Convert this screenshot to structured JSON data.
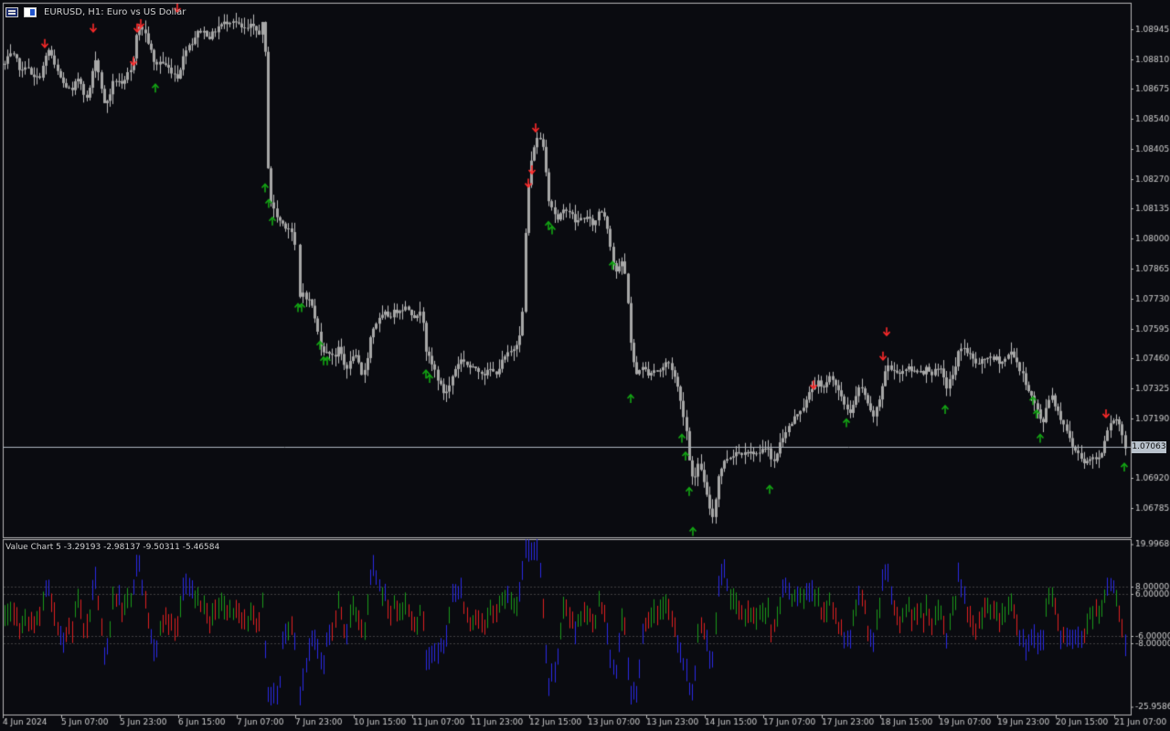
{
  "window": {
    "symbol_title": "EURUSD, H1:  Euro vs US Dollar",
    "icons": [
      "chart-grid-icon",
      "one-click-trading-icon"
    ]
  },
  "main_chart": {
    "price_axis_labels": [
      "1.08945",
      "1.08810",
      "1.08675",
      "1.08540",
      "1.08405",
      "1.08270",
      "1.08135",
      "1.08000",
      "1.07865",
      "1.07730",
      "1.07595",
      "1.07460",
      "1.07325",
      "1.07190",
      "1.06920",
      "1.06785"
    ],
    "current_price": "1.07063",
    "colors": {
      "background": "#0a0b10",
      "candle": "#a7a7a7",
      "candle_wick": "#bdbdbd",
      "up_arrow": "#14a814",
      "down_arrow": "#ff2a2a",
      "price_line": "#b0b8c0",
      "grid_border": "#b8b8b8"
    }
  },
  "indicator": {
    "label": "Value Chart 5 -3.29193 -2.98137 -9.50311 -5.46584",
    "axis_labels": [
      "19.99680",
      "8.00000",
      "6.00000",
      "-6.00000",
      "-8.00000",
      "-25.95862"
    ],
    "colors": {
      "green": "#1a9a1a",
      "red": "#e02020",
      "blue": "#2a2ae6",
      "level_line": "#404040"
    }
  },
  "time_axis_labels": [
    "4 Jun 2024",
    "5 Jun 07:00",
    "5 Jun 23:00",
    "6 Jun 15:00",
    "7 Jun 07:00",
    "7 Jun 23:00",
    "10 Jun 15:00",
    "11 Jun 07:00",
    "11 Jun 23:00",
    "12 Jun 15:00",
    "13 Jun 07:00",
    "13 Jun 23:00",
    "14 Jun 15:00",
    "17 Jun 07:00",
    "17 Jun 23:00",
    "18 Jun 15:00",
    "19 Jun 07:00",
    "19 Jun 23:00",
    "20 Jun 15:00",
    "21 Jun 07:00"
  ],
  "chart_data": {
    "type": "candlestick",
    "title": "EURUSD, H1:  Euro vs US Dollar",
    "xlabel": "",
    "ylabel": "",
    "ylim": [
      1.0665,
      1.0907
    ],
    "close_approx": [
      [
        0,
        1.0872
      ],
      [
        6,
        1.088
      ],
      [
        12,
        1.0883
      ],
      [
        17,
        1.0881
      ],
      [
        20,
        1.0878
      ],
      [
        24,
        1.0875
      ],
      [
        29,
        1.088
      ],
      [
        34,
        1.0873
      ],
      [
        39,
        1.0872
      ],
      [
        44,
        1.0874
      ],
      [
        49,
        1.0881
      ],
      [
        54,
        1.0886
      ],
      [
        59,
        1.0878
      ],
      [
        64,
        1.0874
      ],
      [
        69,
        1.087
      ],
      [
        74,
        1.0868
      ],
      [
        79,
        1.0866
      ],
      [
        84,
        1.0873
      ],
      [
        89,
        1.087
      ],
      [
        94,
        1.0862
      ],
      [
        99,
        1.087
      ],
      [
        104,
        1.0882
      ],
      [
        109,
        1.0872
      ],
      [
        114,
        1.086
      ],
      [
        119,
        1.0864
      ],
      [
        124,
        1.0871
      ],
      [
        129,
        1.0872
      ],
      [
        134,
        1.0868
      ],
      [
        139,
        1.0874
      ],
      [
        144,
        1.0876
      ],
      [
        149,
        1.0893
      ],
      [
        154,
        1.0896
      ],
      [
        159,
        1.0892
      ],
      [
        164,
        1.0886
      ],
      [
        169,
        1.0878
      ],
      [
        174,
        1.088
      ],
      [
        179,
        1.0879
      ],
      [
        184,
        1.0877
      ],
      [
        189,
        1.0875
      ],
      [
        194,
        1.0873
      ],
      [
        199,
        1.088
      ],
      [
        204,
        1.0887
      ],
      [
        209,
        1.0888
      ],
      [
        214,
        1.0892
      ],
      [
        219,
        1.0894
      ],
      [
        224,
        1.0893
      ],
      [
        229,
        1.0891
      ],
      [
        234,
        1.0893
      ],
      [
        239,
        1.0896
      ],
      [
        244,
        1.0897
      ],
      [
        249,
        1.0898
      ],
      [
        254,
        1.0899
      ],
      [
        259,
        1.0897
      ],
      [
        264,
        1.0895
      ],
      [
        269,
        1.0894
      ],
      [
        274,
        1.0896
      ],
      [
        279,
        1.0894
      ],
      [
        284,
        1.0893
      ],
      [
        289,
        1.09
      ],
      [
        292,
        1.0838
      ],
      [
        296,
        1.0817
      ],
      [
        301,
        1.0811
      ],
      [
        306,
        1.0808
      ],
      [
        311,
        1.0806
      ],
      [
        316,
        1.0805
      ],
      [
        321,
        1.0801
      ],
      [
        326,
        1.0771
      ],
      [
        331,
        1.0776
      ],
      [
        336,
        1.0773
      ],
      [
        341,
        1.077
      ],
      [
        346,
        1.076
      ],
      [
        351,
        1.0752
      ],
      [
        356,
        1.0748
      ],
      [
        361,
        1.0749
      ],
      [
        366,
        1.0747
      ],
      [
        371,
        1.0751
      ],
      [
        376,
        1.0743
      ],
      [
        381,
        1.0742
      ],
      [
        386,
        1.0748
      ],
      [
        391,
        1.0745
      ],
      [
        396,
        1.0737
      ],
      [
        401,
        1.0745
      ],
      [
        406,
        1.0758
      ],
      [
        411,
        1.0762
      ],
      [
        416,
        1.0764
      ],
      [
        421,
        1.0766
      ],
      [
        426,
        1.0765
      ],
      [
        431,
        1.0767
      ],
      [
        436,
        1.0768
      ],
      [
        441,
        1.0769
      ],
      [
        446,
        1.0769
      ],
      [
        451,
        1.0766
      ],
      [
        456,
        1.0764
      ],
      [
        461,
        1.077
      ],
      [
        466,
        1.0749
      ],
      [
        471,
        1.0744
      ],
      [
        476,
        1.074
      ],
      [
        481,
        1.0734
      ],
      [
        486,
        1.073
      ],
      [
        491,
        1.0733
      ],
      [
        496,
        1.074
      ],
      [
        501,
        1.0744
      ],
      [
        506,
        1.0746
      ],
      [
        511,
        1.0743
      ],
      [
        516,
        1.0741
      ],
      [
        521,
        1.0742
      ],
      [
        526,
        1.074
      ],
      [
        531,
        1.0739
      ],
      [
        536,
        1.0741
      ],
      [
        541,
        1.0739
      ],
      [
        546,
        1.0742
      ],
      [
        551,
        1.0746
      ],
      [
        556,
        1.0748
      ],
      [
        561,
        1.075
      ],
      [
        566,
        1.0754
      ],
      [
        571,
        1.0762
      ],
      [
        576,
        1.0818
      ],
      [
        580,
        1.0832
      ],
      [
        585,
        1.0844
      ],
      [
        590,
        1.0846
      ],
      [
        595,
        1.084
      ],
      [
        600,
        1.0818
      ],
      [
        605,
        1.0813
      ],
      [
        610,
        1.0808
      ],
      [
        615,
        1.0812
      ],
      [
        620,
        1.0814
      ],
      [
        625,
        1.0811
      ],
      [
        630,
        1.0807
      ],
      [
        635,
        1.0809
      ],
      [
        640,
        1.081
      ],
      [
        645,
        1.0808
      ],
      [
        650,
        1.0806
      ],
      [
        655,
        1.0813
      ],
      [
        660,
        1.0812
      ],
      [
        665,
        1.0804
      ],
      [
        670,
        1.079
      ],
      [
        675,
        1.0784
      ],
      [
        680,
        1.079
      ],
      [
        685,
        1.0781
      ],
      [
        690,
        1.0752
      ],
      [
        695,
        1.0738
      ],
      [
        700,
        1.0742
      ],
      [
        705,
        1.0741
      ],
      [
        710,
        1.0739
      ],
      [
        715,
        1.0741
      ],
      [
        720,
        1.074
      ],
      [
        725,
        1.0742
      ],
      [
        730,
        1.0745
      ],
      [
        735,
        1.0741
      ],
      [
        740,
        1.0735
      ],
      [
        745,
        1.0725
      ],
      [
        750,
        1.0716
      ],
      [
        755,
        1.0695
      ],
      [
        760,
        1.0692
      ],
      [
        765,
        1.07
      ],
      [
        770,
        1.0689
      ],
      [
        775,
        1.068
      ],
      [
        780,
        1.0674
      ],
      [
        785,
        1.0692
      ],
      [
        790,
        1.0698
      ],
      [
        795,
        1.0701
      ],
      [
        800,
        1.0702
      ],
      [
        805,
        1.0704
      ],
      [
        810,
        1.0703
      ],
      [
        815,
        1.0705
      ],
      [
        820,
        1.0703
      ],
      [
        825,
        1.0704
      ],
      [
        830,
        1.0702
      ],
      [
        835,
        1.0705
      ],
      [
        840,
        1.0707
      ],
      [
        845,
        1.0697
      ],
      [
        850,
        1.0704
      ],
      [
        855,
        1.071
      ],
      [
        860,
        1.0714
      ],
      [
        865,
        1.0716
      ],
      [
        870,
        1.072
      ],
      [
        875,
        1.0723
      ],
      [
        880,
        1.0725
      ],
      [
        885,
        1.073
      ],
      [
        890,
        1.0734
      ],
      [
        895,
        1.0735
      ],
      [
        900,
        1.0731
      ],
      [
        905,
        1.0737
      ],
      [
        910,
        1.0738
      ],
      [
        915,
        1.0733
      ],
      [
        920,
        1.0728
      ],
      [
        925,
        1.0724
      ],
      [
        930,
        1.0722
      ],
      [
        935,
        1.0727
      ],
      [
        940,
        1.0733
      ],
      [
        945,
        1.0731
      ],
      [
        950,
        1.0723
      ],
      [
        955,
        1.072
      ],
      [
        960,
        1.0724
      ],
      [
        965,
        1.0734
      ],
      [
        970,
        1.0744
      ],
      [
        975,
        1.074
      ],
      [
        980,
        1.0741
      ],
      [
        985,
        1.0739
      ],
      [
        990,
        1.0742
      ],
      [
        995,
        1.0741
      ],
      [
        1000,
        1.074
      ],
      [
        1005,
        1.0741
      ],
      [
        1010,
        1.074
      ],
      [
        1015,
        1.0742
      ],
      [
        1020,
        1.0739
      ],
      [
        1025,
        1.0741
      ],
      [
        1030,
        1.074
      ],
      [
        1035,
        1.0733
      ],
      [
        1040,
        1.0737
      ],
      [
        1045,
        1.0742
      ],
      [
        1050,
        1.0752
      ],
      [
        1055,
        1.075
      ],
      [
        1060,
        1.0748
      ],
      [
        1065,
        1.0745
      ],
      [
        1070,
        1.0743
      ],
      [
        1075,
        1.0745
      ],
      [
        1080,
        1.0747
      ],
      [
        1085,
        1.0745
      ],
      [
        1090,
        1.0746
      ],
      [
        1095,
        1.0744
      ],
      [
        1100,
        1.0746
      ],
      [
        1105,
        1.0749
      ],
      [
        1110,
        1.0747
      ],
      [
        1115,
        1.0741
      ],
      [
        1120,
        1.0737
      ],
      [
        1125,
        1.0732
      ],
      [
        1130,
        1.0727
      ],
      [
        1135,
        1.0722
      ],
      [
        1140,
        1.0715
      ],
      [
        1145,
        1.0726
      ],
      [
        1150,
        1.073
      ],
      [
        1155,
        1.0724
      ],
      [
        1160,
        1.0719
      ],
      [
        1165,
        1.0716
      ],
      [
        1170,
        1.0709
      ],
      [
        1175,
        1.0705
      ],
      [
        1180,
        1.0703
      ],
      [
        1185,
        1.07
      ],
      [
        1190,
        1.0699
      ],
      [
        1195,
        1.0702
      ],
      [
        1200,
        1.07
      ],
      [
        1205,
        1.0704
      ],
      [
        1210,
        1.0713
      ],
      [
        1215,
        1.0718
      ],
      [
        1220,
        1.0719
      ],
      [
        1225,
        1.0716
      ],
      [
        1230,
        1.0706
      ]
    ],
    "up_arrows": [
      [
        170,
        1.0868
      ],
      [
        290,
        1.0823
      ],
      [
        294,
        1.0816
      ],
      [
        298,
        1.0808
      ],
      [
        326,
        1.0769
      ],
      [
        330,
        1.0769
      ],
      [
        350,
        1.0752
      ],
      [
        354,
        1.0745
      ],
      [
        358,
        1.0745
      ],
      [
        466,
        1.0739
      ],
      [
        470,
        1.0737
      ],
      [
        600,
        1.0806
      ],
      [
        604,
        1.0804
      ],
      [
        670,
        1.0788
      ],
      [
        690,
        1.0728
      ],
      [
        746,
        1.071
      ],
      [
        750,
        1.0702
      ],
      [
        754,
        1.0686
      ],
      [
        758,
        1.0668
      ],
      [
        842,
        1.0687
      ],
      [
        926,
        1.0717
      ],
      [
        1034,
        1.0723
      ],
      [
        1130,
        1.0727
      ],
      [
        1134,
        1.0721
      ],
      [
        1138,
        1.071
      ],
      [
        1230,
        1.0697
      ]
    ],
    "down_arrows": [
      [
        49,
        1.0888
      ],
      [
        102,
        1.0895
      ],
      [
        146,
        1.088
      ],
      [
        150,
        1.0895
      ],
      [
        154,
        1.0897
      ],
      [
        194,
        1.0904
      ],
      [
        578,
        1.0825
      ],
      [
        582,
        1.0831
      ],
      [
        586,
        1.085
      ],
      [
        890,
        1.0734
      ],
      [
        966,
        1.0747
      ],
      [
        970,
        1.0758
      ],
      [
        1210,
        1.0721
      ]
    ],
    "value_chart_levels": [
      8,
      6,
      -6,
      -8
    ],
    "value_chart_range": [
      -25.95862,
      19.9968
    ]
  }
}
